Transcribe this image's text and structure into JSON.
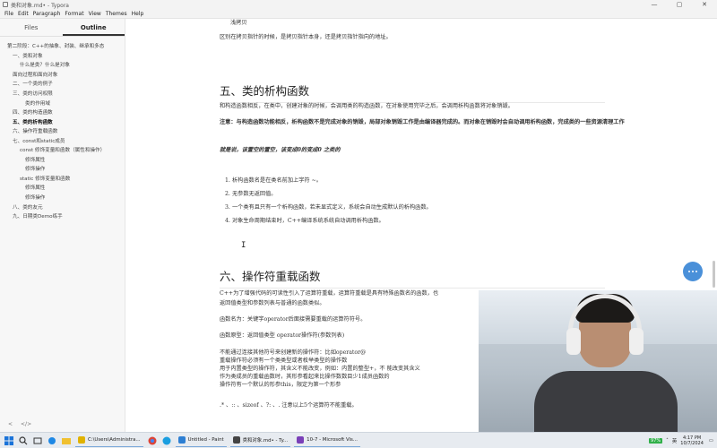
{
  "window": {
    "title": "类和对象.md• - Typora",
    "controls": [
      "—",
      "▢",
      "✕"
    ]
  },
  "menu": [
    "File",
    "Edit",
    "Paragraph",
    "Format",
    "View",
    "Themes",
    "Help"
  ],
  "sidebar": {
    "tabs": [
      "Files",
      "Outline"
    ],
    "active_tab": "Outline",
    "outline": [
      {
        "level": 0,
        "label": "第二阶段：C++的抽象、封装、继承和多态"
      },
      {
        "level": 1,
        "label": "一、类和对象"
      },
      {
        "level": 2,
        "label": "什么是类？什么是对象"
      },
      {
        "level": 1,
        "label": "面向过程和面向对象"
      },
      {
        "level": 1,
        "label": "二、一个类的例子"
      },
      {
        "level": 1,
        "label": "三、类的访问权限"
      },
      {
        "level": 3,
        "label": "类的作用域"
      },
      {
        "level": 1,
        "label": "四、类的构造函数"
      },
      {
        "level": 1,
        "label": "五、类的析构函数",
        "active": true
      },
      {
        "level": 1,
        "label": "六、操作符重载函数"
      },
      {
        "level": 1,
        "label": "七、const和static成员"
      },
      {
        "level": 2,
        "label": "const 修饰变量和函数（属性和操作）"
      },
      {
        "level": 3,
        "label": "修饰属性"
      },
      {
        "level": 3,
        "label": "修饰操作"
      },
      {
        "level": 2,
        "label": "static 修饰变量和函数"
      },
      {
        "level": 3,
        "label": "修饰属性"
      },
      {
        "level": 3,
        "label": "修饰操作"
      },
      {
        "level": 1,
        "label": "八、类的友元"
      },
      {
        "level": 1,
        "label": "九、日期类Demo练手"
      }
    ],
    "bottom": [
      "<",
      "</>"
    ]
  },
  "doc": {
    "top_item": "浅拷贝",
    "intro": "区别在拷贝指针的时候，是拷贝指针本身，还是拷贝指针指向的地址。",
    "h5": "五、类的析构函数",
    "p1": "和构造函数相反，在类中，创建对象的时候，会调用类的构造函数，在对象使用完毕之后，会调用析构函数将对象销毁。",
    "note": "注意：与构造函数功能相反，析构函数不是完成对象的销毁，局部对象销毁工作是由编译器完成的。而对象在销毁时会自动调用析构函数，完成类的一些资源清理工作",
    "quote": "就是说，该置空的置空，该变成0的变成0 之类的",
    "list": [
      "析构函数名是在类名前加上字符 ~。",
      "无参数无返回值。",
      "一个类有且只有一个析构函数，若未显式定义，系统会自动生成默认的析构函数。",
      "对象生命周期结束时，C++编译系统系统自动调用析构函数。"
    ],
    "h6": "六、操作符重载函数",
    "p2a": "C++为了增强代码的可读性引入了运算符重载，运算符重载是具有特殊函数名的函数，也",
    "p2b": "返回值类型和参数列表与普通的函数类似。",
    "p3": "函数名为：关键字operator后面接需要重载的运算符符号。",
    "p4": "函数原型：返回值类型 operator操作符(参数列表)",
    "p5": [
      "不能通过连接其他符号来创建新的操作符：比如operator@",
      "重载操作符必须有一个类类型或者枚举类型的操作数",
      "用于内置类型的操作符，其含义不能改变，例如：内置的整型+，不 能改变其含义",
      "作为类成员的重载函数时，其形参看起来比操作数数目少1成员函数的",
      "操作符有一个默认的形参this，限定为第一个形参"
    ],
    "p6": ".* 、:: 、sizeof 、?: 、. 注意以上5个运算符不能重载。"
  },
  "taskbar": {
    "apps": [
      {
        "label": "C:\\Users\\Administra...",
        "color": "#e0b200"
      },
      {
        "label": "Untitled - Paint",
        "color": "#2d7fd3"
      },
      {
        "label": "类和对象.md• - Ty...",
        "color": "#444444"
      },
      {
        "label": "10-7 - Microsoft Vis...",
        "color": "#7a3fb8"
      }
    ],
    "battery": "97%",
    "lang": "英",
    "time": "4:17 PM",
    "date": "10/7/2024"
  }
}
